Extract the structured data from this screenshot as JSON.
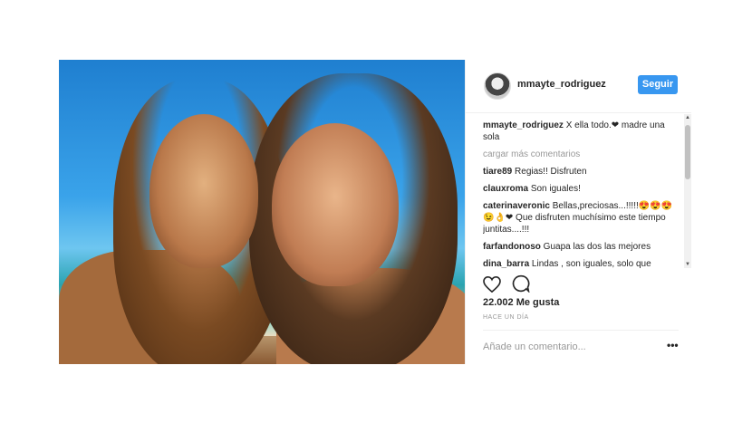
{
  "header": {
    "username": "mmayte_rodriguez",
    "follow_label": "Seguir"
  },
  "caption": {
    "user": "mmayte_rodriguez",
    "text": "X ella todo.❤ madre una sola"
  },
  "load_more": "cargar más comentarios",
  "comments": [
    {
      "user": "tiare89",
      "text": "Regias!! Disfruten"
    },
    {
      "user": "clauxroma",
      "text": "Son iguales!"
    },
    {
      "user": "caterinaveronic",
      "text": "Bellas,preciosas...!!!!!😍😍😍 😉👌❤ Que disfruten muchísimo este tiempo juntitas....!!!"
    },
    {
      "user": "farfandonoso",
      "text": "Guapa las dos las mejores"
    },
    {
      "user": "dina_barra",
      "text": "Lindas , son iguales, solo que"
    }
  ],
  "likes": "22.002 Me gusta",
  "time": "HACE UN DÍA",
  "add_comment_placeholder": "Añade un comentario...",
  "more_options": "•••"
}
